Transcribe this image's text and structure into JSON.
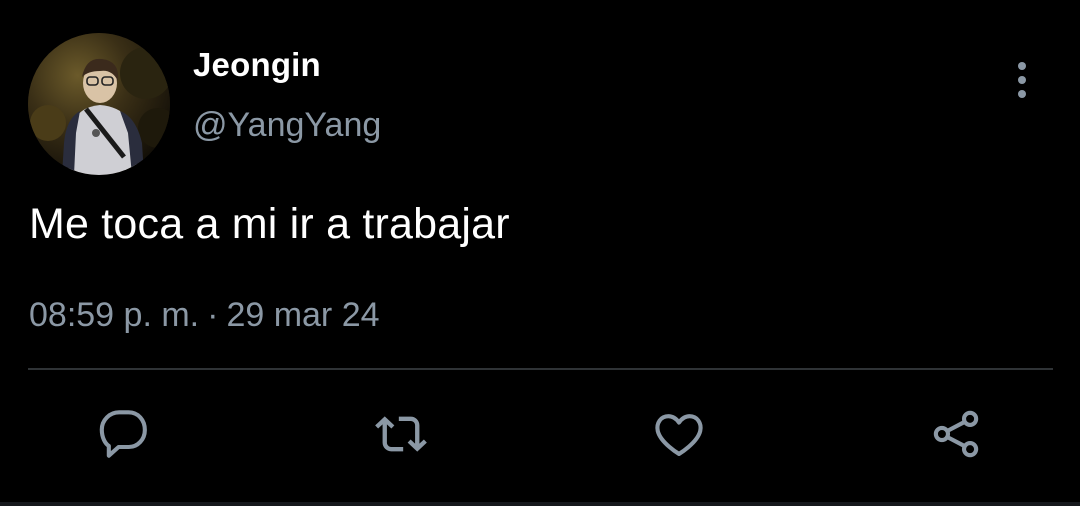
{
  "author": {
    "display_name": "Jeongin",
    "handle": "@YangYang"
  },
  "tweet": {
    "text": "Me toca a mi ir a trabajar",
    "time": "08:59 p. m.",
    "separator": "·",
    "date": "29 mar 24"
  },
  "actions": [
    {
      "icon": "reply-icon"
    },
    {
      "icon": "retweet-icon"
    },
    {
      "icon": "like-icon"
    },
    {
      "icon": "share-icon"
    }
  ],
  "colors": {
    "background": "#000000",
    "primary_text": "#ffffff",
    "secondary_text": "#8b98a5",
    "divider": "#2f3336"
  }
}
